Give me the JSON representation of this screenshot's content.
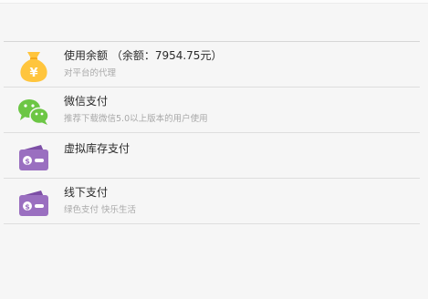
{
  "payment_methods": [
    {
      "title": "使用余额 （余额：7954.75元）",
      "subtitle": "对平台的代理",
      "icon": "money-bag-icon",
      "icon_color": "#ffc53d"
    },
    {
      "title": "微信支付",
      "subtitle": "推荐下载微信5.0以上版本的用户使用",
      "icon": "wechat-icon",
      "icon_color": "#6cc644"
    },
    {
      "title": "虚拟库存支付",
      "subtitle": "",
      "icon": "wallet-icon",
      "icon_color": "#9a6fc0"
    },
    {
      "title": "线下支付",
      "subtitle": "绿色支付 快乐生活",
      "icon": "wallet-icon",
      "icon_color": "#9a6fc0"
    }
  ]
}
